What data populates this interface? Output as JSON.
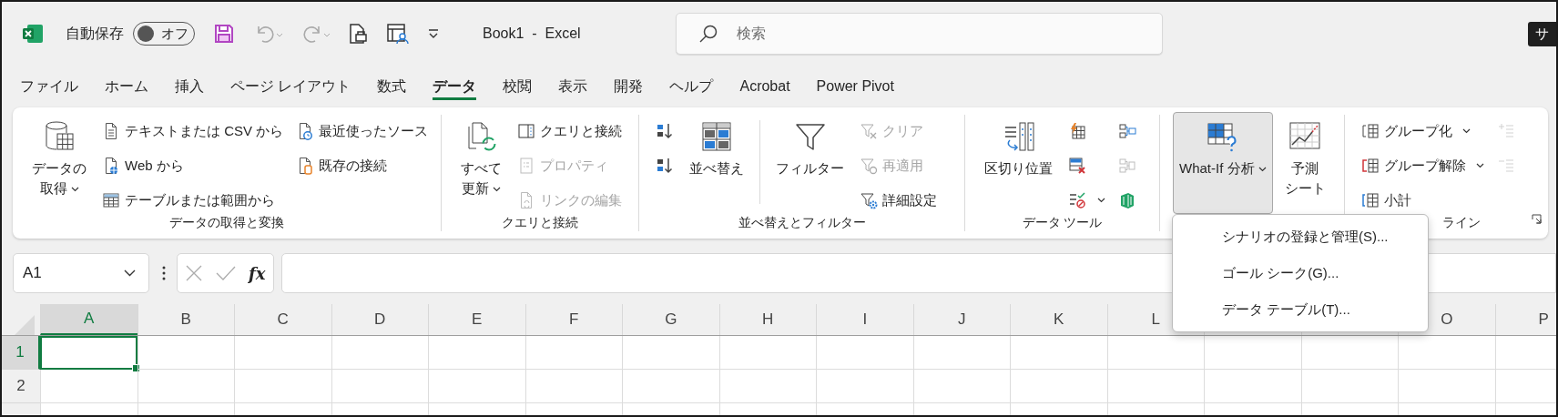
{
  "title_bar": {
    "autosave_label": "自動保存",
    "autosave": {
      "label": "オフ",
      "on": false
    },
    "undo": {
      "disabled": true
    },
    "redo": {
      "disabled": true
    },
    "document_title": "Book1  -  Excel",
    "search": {
      "placeholder": "検索"
    },
    "account": "サ"
  },
  "tabs": [
    {
      "label": "ファイル",
      "selected": false
    },
    {
      "label": "ホーム",
      "selected": false
    },
    {
      "label": "挿入",
      "selected": false
    },
    {
      "label": "ページ レイアウト",
      "selected": false
    },
    {
      "label": "数式",
      "selected": false
    },
    {
      "label": "データ",
      "selected": true
    },
    {
      "label": "校閲",
      "selected": false
    },
    {
      "label": "表示",
      "selected": false
    },
    {
      "label": "開発",
      "selected": false
    },
    {
      "label": "ヘルプ",
      "selected": false
    },
    {
      "label": "Acrobat",
      "selected": false
    },
    {
      "label": "Power Pivot",
      "selected": false
    }
  ],
  "ribbon": {
    "groups": [
      {
        "label": "データの取得と変換",
        "columns": [
          {
            "kind": "large",
            "label": [
              "データの",
              "取得"
            ],
            "dropdown": true,
            "expanded": false
          },
          {
            "kind": "stack",
            "items": [
              {
                "label": "テキストまたは CSV から",
                "disabled": false
              },
              {
                "label": "Web から",
                "disabled": false
              },
              {
                "label": "テーブルまたは範囲から",
                "disabled": false
              }
            ]
          },
          {
            "kind": "stack",
            "items": [
              {
                "label": "最近使ったソース",
                "disabled": false
              },
              {
                "label": "既存の接続",
                "disabled": false
              }
            ]
          }
        ]
      },
      {
        "label": "クエリと接続",
        "columns": [
          {
            "kind": "large",
            "label": [
              "すべて",
              "更新"
            ],
            "dropdown": true,
            "expanded": false
          },
          {
            "kind": "stack",
            "items": [
              {
                "label": "クエリと接続",
                "disabled": false
              },
              {
                "label": "プロパティ",
                "disabled": true
              },
              {
                "label": "リンクの編集",
                "disabled": true
              }
            ]
          }
        ]
      },
      {
        "label": "並べ替えとフィルター",
        "columns": [
          {
            "kind": "stack",
            "items": [
              {
                "disabled": false
              },
              {
                "disabled": false
              }
            ]
          },
          {
            "kind": "large",
            "label": [
              "並べ替え"
            ],
            "dropdown": false,
            "expanded": false
          },
          {
            "kind": "divider"
          },
          {
            "kind": "large",
            "label": [
              "フィルター"
            ],
            "dropdown": false,
            "expanded": false
          },
          {
            "kind": "stack",
            "items": [
              {
                "label": "クリア",
                "disabled": true
              },
              {
                "label": "再適用",
                "disabled": true
              },
              {
                "label": "詳細設定",
                "disabled": false
              }
            ]
          }
        ]
      },
      {
        "label": "データ ツール",
        "columns": [
          {
            "kind": "large",
            "label": [
              "区切り位置"
            ],
            "dropdown": false,
            "expanded": false
          },
          {
            "kind": "stack",
            "items": [
              {
                "disabled": false
              },
              {
                "disabled": false
              },
              {
                "disabled": false,
                "dropdown": true
              }
            ]
          },
          {
            "kind": "stack",
            "items": [
              {
                "disabled": false
              },
              {
                "disabled": true
              },
              {
                "disabled": false
              }
            ]
          }
        ]
      },
      {
        "columns": [
          {
            "kind": "large",
            "label": [
              "What-If 分析"
            ],
            "dropdown": true,
            "expanded": true
          },
          {
            "kind": "large",
            "label": [
              "予測",
              "シート"
            ],
            "dropdown": false,
            "expanded": false
          }
        ]
      },
      {
        "label": "ライン",
        "launcher": true,
        "columns": [
          {
            "kind": "stack",
            "items": [
              {
                "label": "グループ化",
                "dropdown": true,
                "disabled": false
              },
              {
                "label": "グループ解除",
                "dropdown": true,
                "disabled": false
              },
              {
                "label": "小計",
                "disabled": false
              }
            ]
          },
          {
            "kind": "stack",
            "items": [
              {
                "disabled": true
              },
              {
                "disabled": true
              }
            ]
          }
        ]
      }
    ]
  },
  "whatif_menu": {
    "items": [
      {
        "label": "シナリオの登録と管理(S)..."
      },
      {
        "label": "ゴール シーク(G)..."
      },
      {
        "label": "データ テーブル(T)..."
      }
    ]
  },
  "formula_bar": {
    "name_box": "A1",
    "insert_function": "fx"
  },
  "sheet": {
    "columns": [
      {
        "label": "A",
        "selected": true
      },
      {
        "label": "B",
        "selected": false
      },
      {
        "label": "C",
        "selected": false
      },
      {
        "label": "D",
        "selected": false
      },
      {
        "label": "E",
        "selected": false
      },
      {
        "label": "F",
        "selected": false
      },
      {
        "label": "G",
        "selected": false
      },
      {
        "label": "H",
        "selected": false
      },
      {
        "label": "I",
        "selected": false
      },
      {
        "label": "J",
        "selected": false
      },
      {
        "label": "K",
        "selected": false
      },
      {
        "label": "L",
        "selected": false
      },
      {
        "selected": false
      },
      {
        "selected": false
      },
      {
        "label": "O",
        "selected": false
      },
      {
        "label": "P",
        "selected": false
      }
    ],
    "rows": [
      {
        "label": "1",
        "selected": true
      },
      {
        "label": "2",
        "selected": false
      }
    ]
  }
}
